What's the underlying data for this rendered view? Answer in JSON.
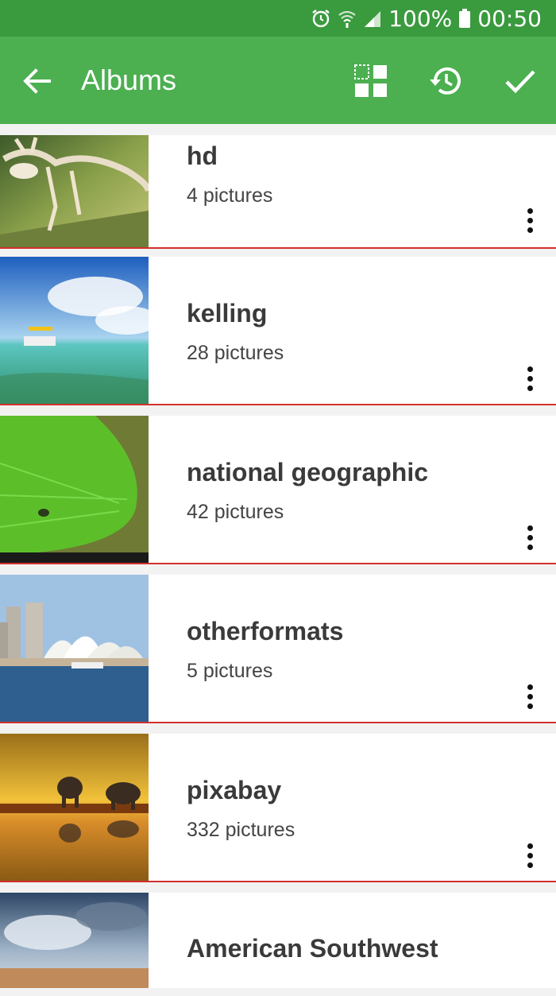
{
  "status_bar": {
    "battery": "100%",
    "time": "00:50"
  },
  "toolbar": {
    "title": "Albums",
    "back_icon": "arrow-back-icon",
    "actions": [
      "select-all-icon",
      "history-icon",
      "check-icon"
    ]
  },
  "albums": [
    {
      "name": "hd",
      "count": "4 pictures",
      "thumb": "mantis"
    },
    {
      "name": "kelling",
      "count": "28 pictures",
      "thumb": "ocean-boat"
    },
    {
      "name": "national geographic",
      "count": "42 pictures",
      "thumb": "leaf-frog"
    },
    {
      "name": "otherformats",
      "count": "5 pictures",
      "thumb": "sydney-opera"
    },
    {
      "name": "pixabay",
      "count": "332 pictures",
      "thumb": "elephants-sunset"
    },
    {
      "name": "American Southwest",
      "thumb": "cloudy-sky"
    }
  ],
  "colors": {
    "status_bar": "#3a9a3e",
    "app_bar": "#4caf50",
    "divider": "#d32f2f"
  }
}
